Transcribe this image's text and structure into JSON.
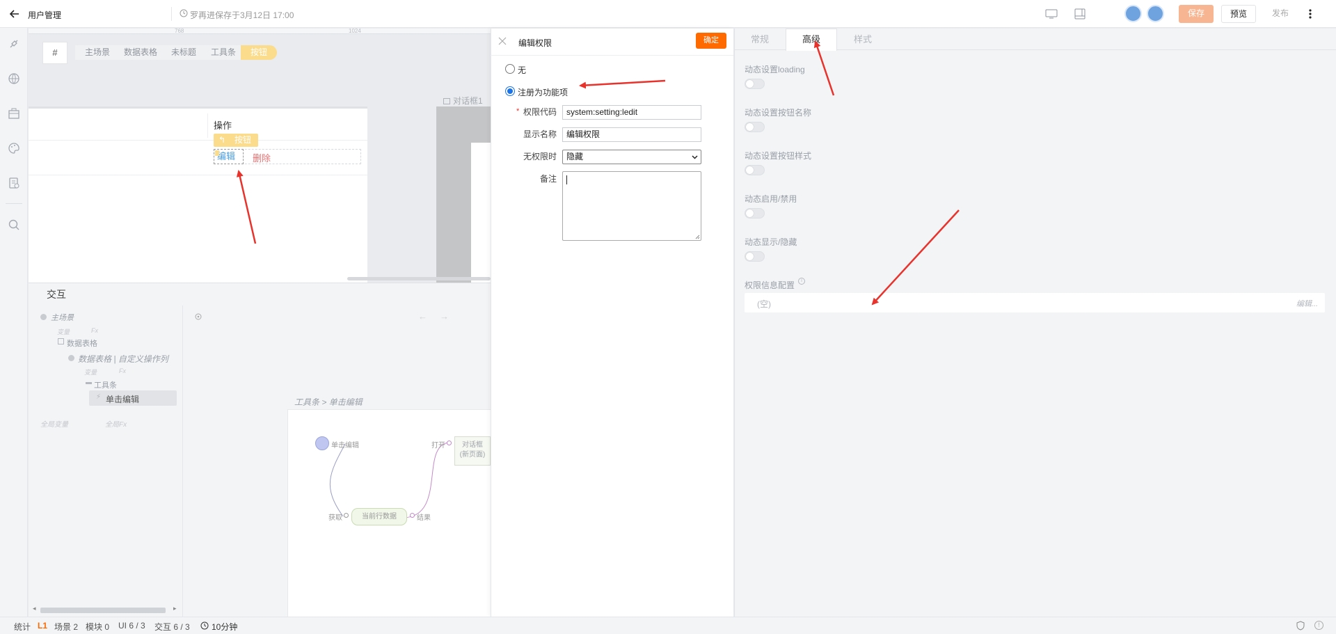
{
  "topbar": {
    "page_title": "用户管理",
    "save_status": "罗再进保存于3月12日 17:00",
    "save_label": "保存",
    "preview_label": "预览",
    "publish_label": "发布"
  },
  "breadcrumb": {
    "hash": "#",
    "items": [
      "主场景",
      "数据表格",
      "未标题",
      "工具条",
      "按钮"
    ]
  },
  "ruler": {
    "t1": "768",
    "t2": "1024"
  },
  "canvas": {
    "column_header": "操作",
    "toolbar_button": "按钮",
    "edit_link": "编辑",
    "delete_link": "删除",
    "dialog_label": "对话框1"
  },
  "interaction": {
    "title": "交互",
    "tree": {
      "scene": "主场景",
      "vars": "变量",
      "fx": "Fx",
      "table": "数据表格",
      "table_col": "数据表格 | 自定义操作列",
      "vars2": "变量",
      "fx2": "Fx",
      "toolbar": "工具条",
      "event": "单击编辑",
      "global_vars": "全局变量",
      "global_fx": "全局Fx"
    },
    "flow_path": "工具条 > 单击编辑",
    "flow": {
      "start": "单击编辑",
      "fetch": "获取",
      "row_data": "当前行数据",
      "result": "结果",
      "open": "打开",
      "dialog_line1": "对话框",
      "dialog_line2": "(新页面)"
    }
  },
  "modal": {
    "title": "编辑权限",
    "confirm_label": "确定",
    "option_none": "无",
    "option_register": "注册为功能项",
    "selected_option": "注册为功能项",
    "code_label": "权限代码",
    "code_value": "system:setting:ledit",
    "name_label": "显示名称",
    "name_value": "编辑权限",
    "noperm_label": "无权限时",
    "noperm_value": "隐藏",
    "remark_label": "备注",
    "remark_value": ""
  },
  "right_panel": {
    "tabs": [
      "常规",
      "高级",
      "样式"
    ],
    "active_tab": "高级",
    "props": [
      {
        "label": "动态设置loading",
        "on": false
      },
      {
        "label": "动态设置按钮名称",
        "on": false
      },
      {
        "label": "动态设置按钮样式",
        "on": false
      },
      {
        "label": "动态启用/禁用",
        "on": false
      },
      {
        "label": "动态显示/隐藏",
        "on": false
      }
    ],
    "perm_label": "权限信息配置",
    "perm_value": "(空)",
    "perm_edit": "编辑..."
  },
  "statusbar": {
    "stats": "统计",
    "level": "L1",
    "scenes": "场景 2",
    "modules": "模块 0",
    "ui": "UI 6 / 3",
    "interact": "交互 6 / 3",
    "duration": "10分钟"
  },
  "colors": {
    "accent": "#ff6a00",
    "save_btn": "#f8b591",
    "highlight": "#fbdc8d",
    "arrow": "#e8322c",
    "link": "#4a9ee0",
    "danger": "#f07070"
  }
}
